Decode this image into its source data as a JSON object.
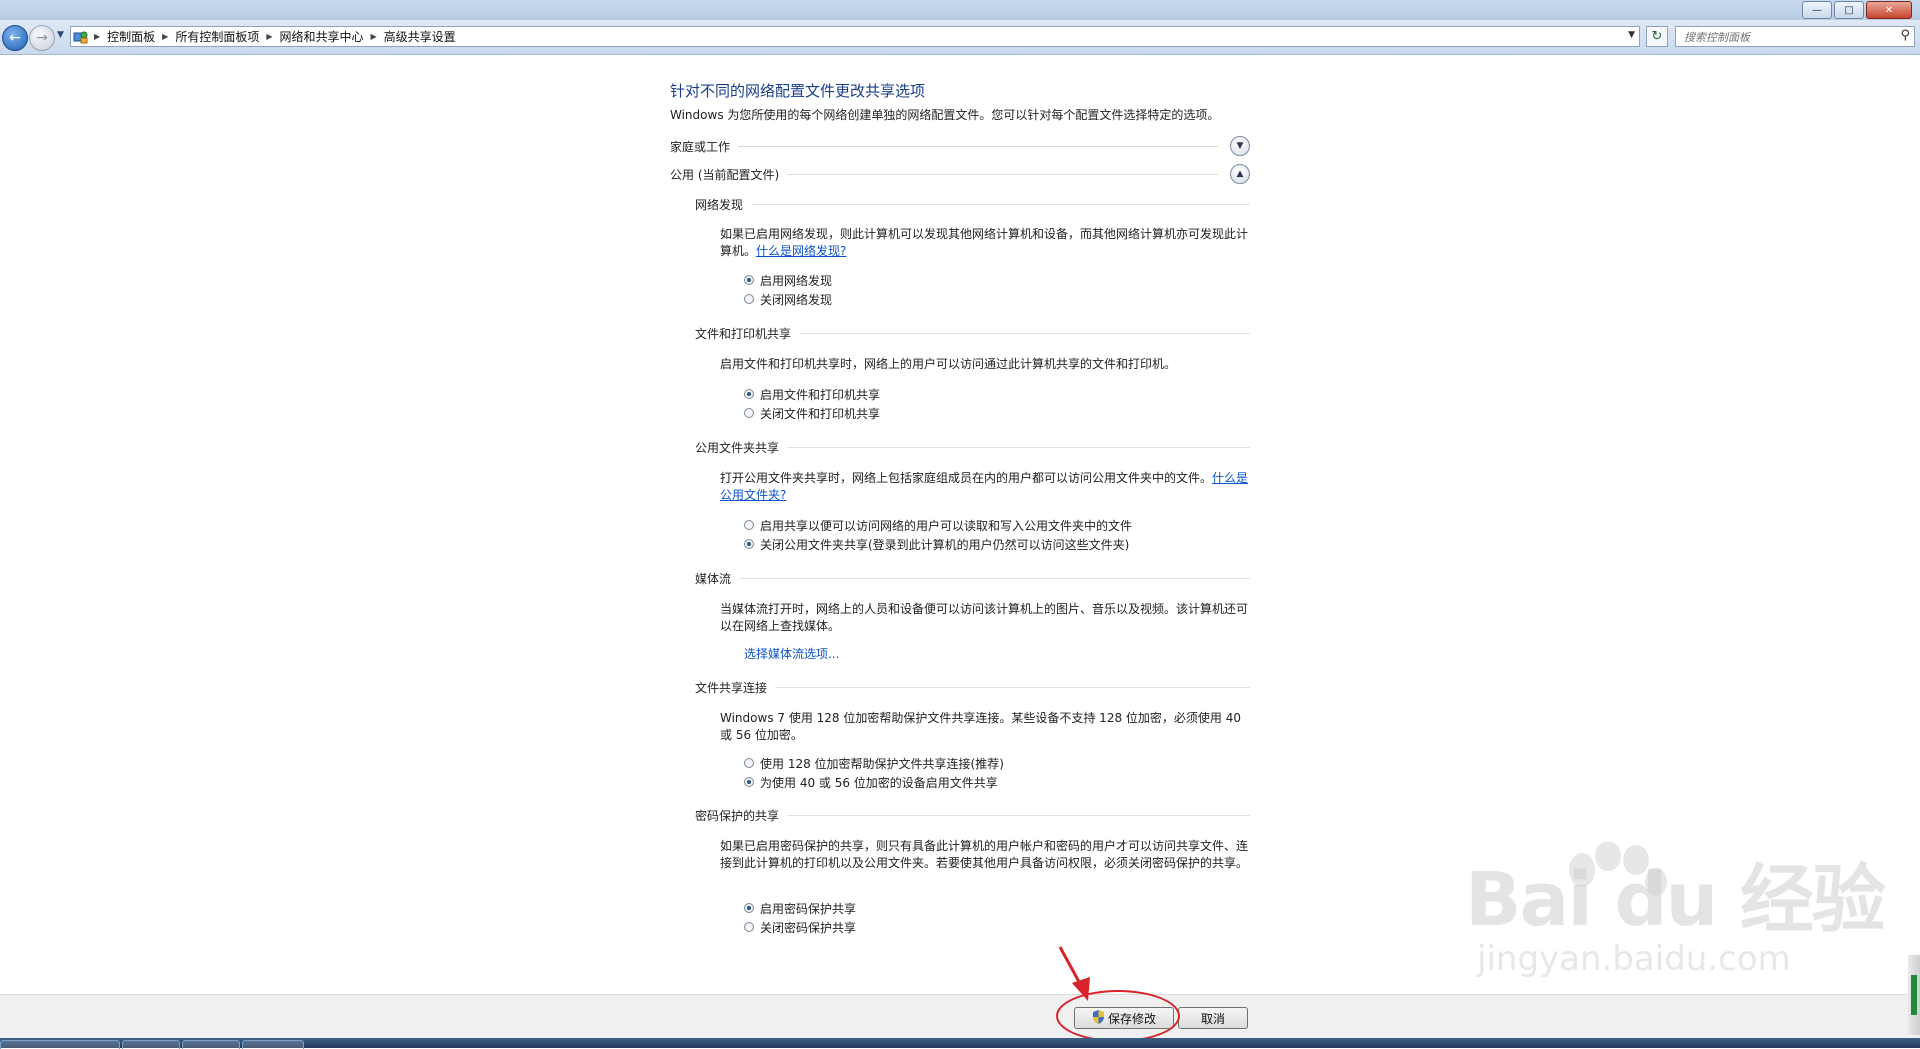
{
  "window": {
    "min_label": "—",
    "max_label": "□",
    "close_label": "✕"
  },
  "breadcrumb": {
    "items": [
      "控制面板",
      "所有控制面板项",
      "网络和共享中心",
      "高级共享设置"
    ]
  },
  "search": {
    "placeholder": "搜索控制面板"
  },
  "page": {
    "title": "针对不同的网络配置文件更改共享选项",
    "intro": "Windows 为您所使用的每个网络创建单独的网络配置文件。您可以针对每个配置文件选择特定的选项。"
  },
  "profiles": {
    "home": {
      "label": "家庭或工作",
      "expanded": false
    },
    "public": {
      "label": "公用 (当前配置文件)",
      "expanded": true
    }
  },
  "sections": {
    "discovery": {
      "title": "网络发现",
      "desc": "如果已启用网络发现，则此计算机可以发现其他网络计算机和设备，而其他网络计算机亦可发现此计算机。",
      "link": "什么是网络发现?",
      "options": [
        "启用网络发现",
        "关闭网络发现"
      ],
      "selected": 0
    },
    "printer": {
      "title": "文件和打印机共享",
      "desc": "启用文件和打印机共享时，网络上的用户可以访问通过此计算机共享的文件和打印机。",
      "options": [
        "启用文件和打印机共享",
        "关闭文件和打印机共享"
      ],
      "selected": 0
    },
    "public_folder": {
      "title": "公用文件夹共享",
      "desc": "打开公用文件夹共享时，网络上包括家庭组成员在内的用户都可以访问公用文件夹中的文件。",
      "link": "什么是公用文件夹?",
      "options": [
        "启用共享以便可以访问网络的用户可以读取和写入公用文件夹中的文件",
        "关闭公用文件夹共享(登录到此计算机的用户仍然可以访问这些文件夹)"
      ],
      "selected": 1
    },
    "media": {
      "title": "媒体流",
      "desc": "当媒体流打开时，网络上的人员和设备便可以访问该计算机上的图片、音乐以及视频。该计算机还可以在网络上查找媒体。",
      "link": "选择媒体流选项..."
    },
    "encryption": {
      "title": "文件共享连接",
      "desc": "Windows 7 使用 128 位加密帮助保护文件共享连接。某些设备不支持 128 位加密，必须使用 40 或 56 位加密。",
      "options": [
        "使用 128 位加密帮助保护文件共享连接(推荐)",
        "为使用 40 或 56 位加密的设备启用文件共享"
      ],
      "selected": 1
    },
    "password": {
      "title": "密码保护的共享",
      "desc": "如果已启用密码保护的共享，则只有具备此计算机的用户帐户和密码的用户才可以访问共享文件、连接到此计算机的打印机以及公用文件夹。若要使其他用户具备访问权限，必须关闭密码保护的共享。",
      "options": [
        "启用密码保护共享",
        "关闭密码保护共享"
      ],
      "selected": 0
    }
  },
  "footer": {
    "save_label": "保存修改",
    "cancel_label": "取消"
  },
  "watermark": {
    "logo": "Bai du 经验",
    "url": "jingyan.baidu.com"
  },
  "colors": {
    "title_blue": "#1a3e8a",
    "link_blue": "#0b53c9",
    "highlight_red": "#d8232a"
  }
}
